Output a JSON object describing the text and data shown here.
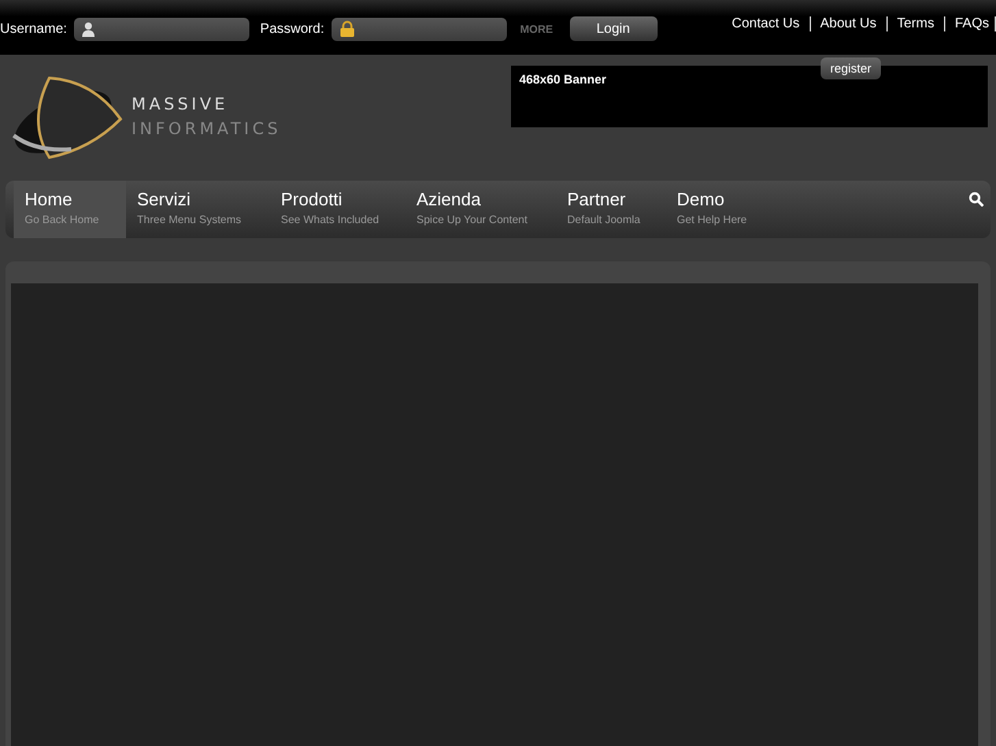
{
  "login": {
    "username_label": "Username:",
    "password_label": "Password:",
    "more": "MORE",
    "login_button": "Login",
    "register_button": "register"
  },
  "top_links": [
    "Contact Us",
    "About Us",
    "Terms",
    "FAQs"
  ],
  "logo": {
    "line_1": "MASSIVE",
    "line_2": "INFORMATICS"
  },
  "banner": {
    "text": "468x60 Banner"
  },
  "nav": [
    {
      "label": "Home",
      "subtitle": "Go Back Home",
      "selected": true
    },
    {
      "label": "Servizi",
      "subtitle": "Three Menu Systems",
      "selected": false
    },
    {
      "label": "Prodotti",
      "subtitle": "See Whats Included",
      "selected": false
    },
    {
      "label": "Azienda",
      "subtitle": "Spice Up Your Content",
      "selected": false
    },
    {
      "label": "Partner",
      "subtitle": "Default Joomla",
      "selected": false
    },
    {
      "label": "Demo",
      "subtitle": "Get Help Here",
      "selected": false
    }
  ]
}
